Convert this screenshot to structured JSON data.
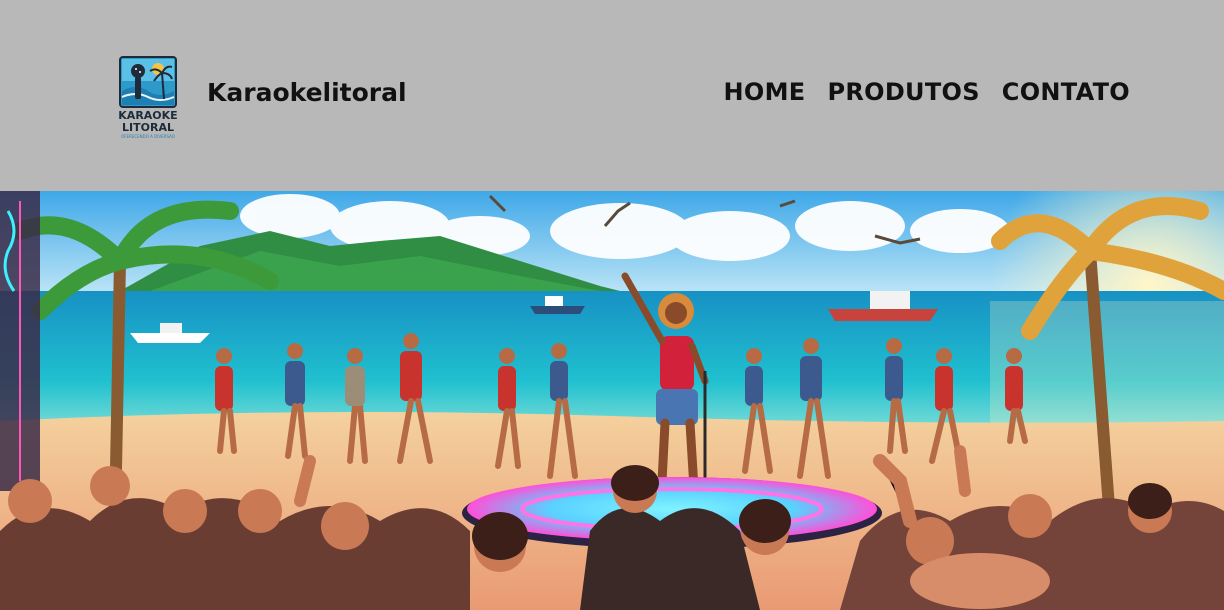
{
  "header": {
    "logo": {
      "line1": "KARAOKE",
      "line2": "LITORAL",
      "tagline": "OFERECENDO A DIVERSÃO",
      "icon": "microphone-palm-logo"
    },
    "site_title": "Karaokelitoral",
    "nav": [
      {
        "label": "HOME"
      },
      {
        "label": "PRODUTOS"
      },
      {
        "label": "CONTATO"
      }
    ]
  },
  "hero": {
    "image": "beach-karaoke-party-illustration"
  },
  "colors": {
    "header_bg": "#b8b8b8",
    "text": "#111111",
    "sea": "#1fb3c8",
    "sand": "#f1c58e",
    "stage_glow": "#ff4fd8"
  }
}
